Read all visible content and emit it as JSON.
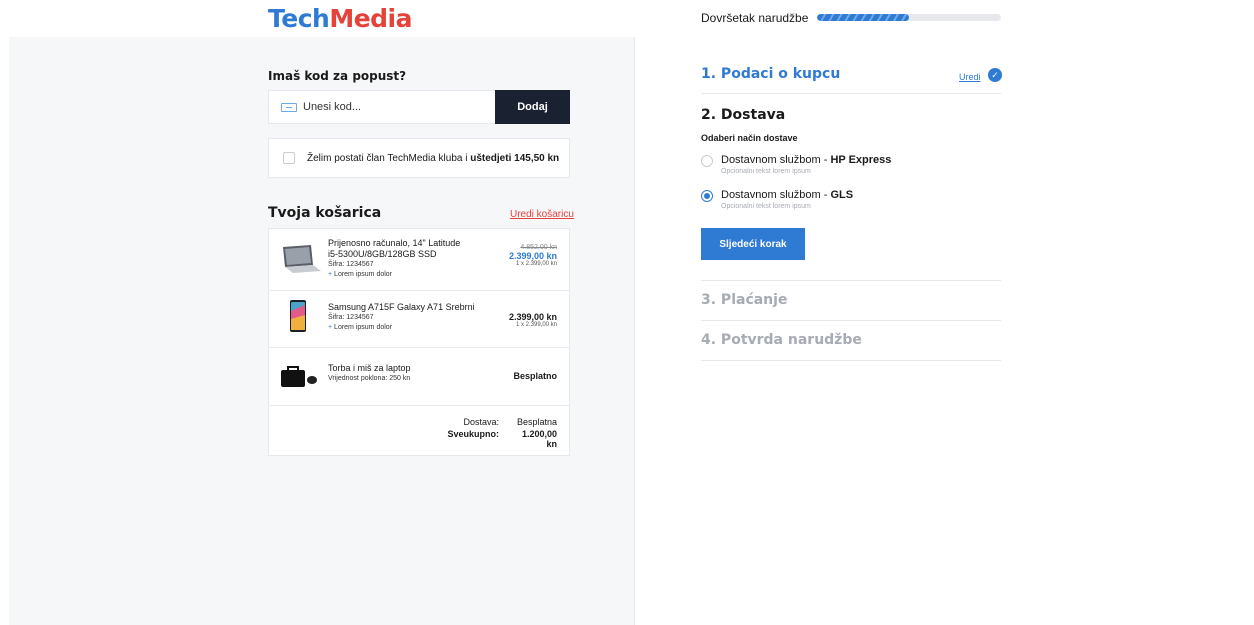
{
  "header": {
    "logo_part1": "Tech",
    "logo_part2": "Media",
    "progress_label": "Dovršetak narudžbe",
    "progress_fraction": 0.5
  },
  "coupon": {
    "title": "Imaš kod za popust?",
    "placeholder": "Unesi kod...",
    "button_label": "Dodaj"
  },
  "club": {
    "text_prefix": "Želim postati član TechMedia kluba i ",
    "text_bold": "uštedjeti 145,50 kn"
  },
  "cart": {
    "title": "Tvoja košarica",
    "edit_label": "Uredi košaricu",
    "items": [
      {
        "name": "Prijenosno računalo, 14\" Latitude i5-5300U/8GB/128GB SSD",
        "sku": "Šifra: 1234567",
        "extra": "Lorem ipsum dolor",
        "old_price": "4.852,00 kn",
        "price": "2.399,00 kn",
        "qty_price": "1 x 2.399,00 kn"
      },
      {
        "name": "Samsung A715F Galaxy A71 Srebrni",
        "sku": "Šifra: 1234567",
        "extra": "Lorem ipsum dolor",
        "price": "2.399,00 kn",
        "qty_price": "1 x 2.399,00 kn"
      },
      {
        "name": "Torba i miš za laptop",
        "sku": "Vrijednost poklona: 250 kn",
        "price_label": "Besplatno"
      }
    ],
    "totals": {
      "shipping_label": "Dostava:",
      "shipping_value": "Besplatna",
      "total_label": "Sveukupno:",
      "total_value": "1.200,00 kn"
    }
  },
  "steps": {
    "step1": {
      "title": "1. Podaci o kupcu",
      "edit_label": "Uredi"
    },
    "step2": {
      "title": "2. Dostava",
      "subtitle": "Odaberi način dostave",
      "options": [
        {
          "label": "Dostavnom službom - ",
          "bold": "HP Express",
          "sub": "Opcionalni tekst lorem ipsum",
          "selected": false
        },
        {
          "label": "Dostavnom službom - ",
          "bold": "GLS",
          "sub": "Opcionalni tekst lorem ipsum",
          "selected": true
        }
      ],
      "next_button": "Sljedeći korak"
    },
    "step3": {
      "title": "3. Plaćanje"
    },
    "step4": {
      "title": "4. Potvrda narudžbe"
    }
  },
  "colors": {
    "accent": "#2f7bd4",
    "brand_red": "#e5423a",
    "dark_button": "#1a2232"
  }
}
